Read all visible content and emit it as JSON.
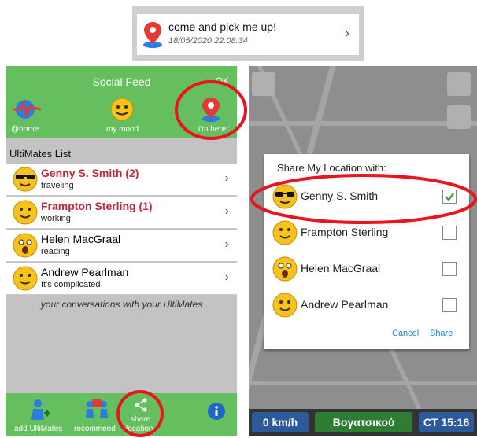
{
  "notification": {
    "title": "come and pick me up!",
    "datetime": "18/05/2020 22:08:34"
  },
  "left": {
    "header": {
      "title": "Social Feed",
      "ok": "OK"
    },
    "toolbar": [
      {
        "label": "@home",
        "icon": "heartbeat-icon"
      },
      {
        "label": "my mood",
        "icon": "smiley-icon"
      },
      {
        "label": "i'm here!",
        "icon": "location-pin-icon"
      }
    ],
    "list_title": "UltiMates List",
    "mates": [
      {
        "name": "Genny S. Smith (2)",
        "status": "traveling",
        "highlight": true,
        "face": "sunglasses"
      },
      {
        "name": "Frampton Sterling (1)",
        "status": "working",
        "highlight": true,
        "face": "smile"
      },
      {
        "name": "Helen MacGraal",
        "status": "reading",
        "highlight": false,
        "face": "surprised"
      },
      {
        "name": "Andrew Pearlman",
        "status": "It's complicated",
        "highlight": false,
        "face": "smile"
      }
    ],
    "conversations_text": "your conversations with your UltiMates",
    "footer": {
      "add": "add UltiMates",
      "recommend": "recommend",
      "share_1": "share",
      "share_2": "location"
    }
  },
  "right": {
    "dialog": {
      "title": "Share My Location with:",
      "contacts": [
        {
          "name": "Genny S. Smith",
          "checked": true
        },
        {
          "name": "Frampton Sterling",
          "checked": false
        },
        {
          "name": "Helen MacGraal",
          "checked": false
        },
        {
          "name": "Andrew Pearlman",
          "checked": false
        }
      ],
      "cancel": "Cancel",
      "share": "Share"
    },
    "bottom": {
      "speed": "0 km/h",
      "street": "Βογατσικού",
      "time": "CT 15:16"
    }
  },
  "colors": {
    "green": "#66bf5f",
    "accent_red": "#c0283e",
    "highlight_circle": "#e8141e"
  }
}
